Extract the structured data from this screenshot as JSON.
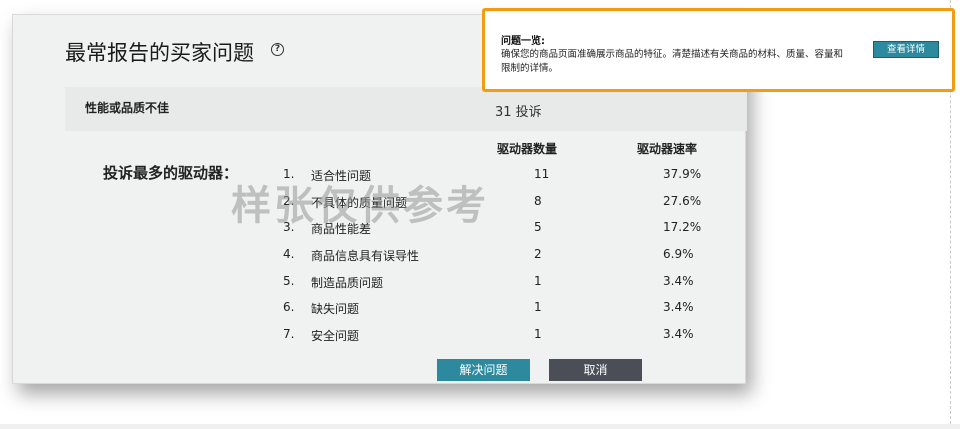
{
  "modal": {
    "title": "最常报告的买家问题",
    "help_icon_text": "?",
    "category": "性能或品质不佳",
    "complaint_partial": "",
    "complaint_count": "31 投诉",
    "drivers_heading": "投诉最多的驱动器：",
    "column_headers": {
      "count": "驱动器数量",
      "rate": "驱动器速率"
    },
    "rows": [
      {
        "index": "1.",
        "name": "适合性问题",
        "count": "11",
        "rate": "37.9%"
      },
      {
        "index": "2.",
        "name": "不具体的质量问题",
        "count": "8",
        "rate": "27.6%"
      },
      {
        "index": "3.",
        "name": "商品性能差",
        "count": "5",
        "rate": "17.2%"
      },
      {
        "index": "4.",
        "name": "商品信息具有误导性",
        "count": "2",
        "rate": "6.9%"
      },
      {
        "index": "5.",
        "name": "制造品质问题",
        "count": "1",
        "rate": "3.4%"
      },
      {
        "index": "6.",
        "name": "缺失问题",
        "count": "1",
        "rate": "3.4%"
      },
      {
        "index": "7.",
        "name": "安全问题",
        "count": "1",
        "rate": "3.4%"
      }
    ],
    "watermark": "样张仅供参考",
    "buttons": {
      "resolve": "解决问题",
      "cancel": "取消"
    }
  },
  "popup": {
    "title": "问题一览:",
    "body": "确保您的商品页面准确展示商品的特征。清楚描述有关商品的材料、质量、容量和限制的详情。",
    "button": "查看详情"
  },
  "colors": {
    "accent_teal": "#2d8a9e",
    "cancel_gray": "#4a4f57",
    "highlight_orange": "#f39c12",
    "modal_bg": "#f0f1f1"
  }
}
